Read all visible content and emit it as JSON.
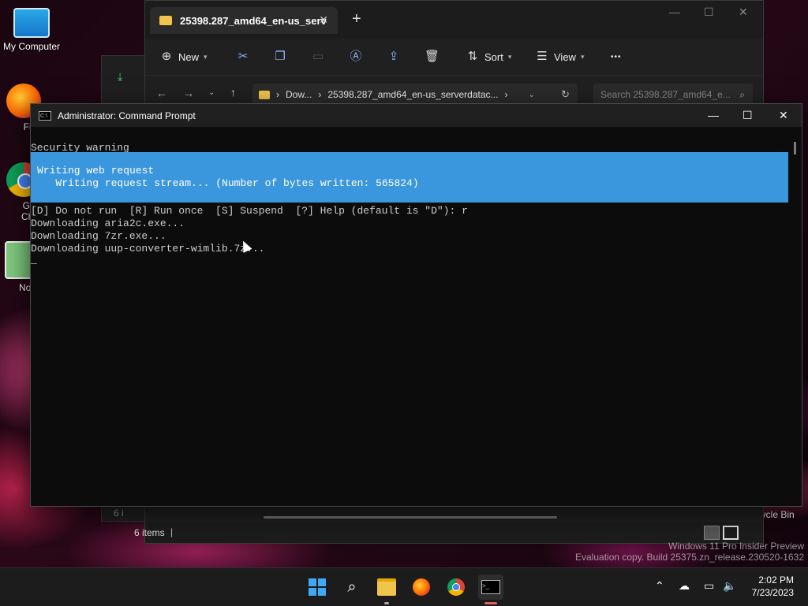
{
  "desktop": {
    "icons": [
      {
        "label": "My Computer"
      },
      {
        "label": "Fire"
      },
      {
        "label": "Goo Chro"
      },
      {
        "label": "Notep"
      },
      {
        "label": "Recycle Bin"
      }
    ]
  },
  "explorer": {
    "tab_title": "25398.287_amd64_en-us_serv",
    "toolbar": {
      "new_label": "New",
      "sort_label": "Sort",
      "view_label": "View",
      "more_label": "•••"
    },
    "address": {
      "crumb1": "Dow...",
      "crumb2": "25398.287_amd64_en-us_serverdatac...",
      "sep": "›"
    },
    "search_placeholder": "Search 25398.287_amd64_e...",
    "status_items": "6 items",
    "hidden_left_text": "6 i"
  },
  "cmd": {
    "title": "Administrator: Command Prompt",
    "lines": {
      "security": "Security warning",
      "progress_title": "Writing web request",
      "progress_detail": "   Writing request stream... (Number of bytes written: 565824)",
      "prompt": "[D] Do not run  [R] Run once  [S] Suspend  [?] Help (default is \"D\"): r",
      "dl1": "Downloading aria2c.exe...",
      "dl2": "Downloading 7zr.exe...",
      "dl3": "Downloading uup-converter-wimlib.7z...",
      "cursor": "_"
    }
  },
  "watermark": {
    "line1": "Windows 11 Pro Insider Preview",
    "line2": "Evaluation copy. Build 25375.zn_release.230520-1632"
  },
  "taskbar": {
    "time": "2:02 PM",
    "date": "7/23/2023",
    "apps": [
      "start-icon",
      "search-icon",
      "file-explorer-icon",
      "firefox-icon",
      "chrome-icon",
      "terminal-icon"
    ]
  },
  "colors": {
    "accent": "#3a96dd",
    "folder": "#f1c44b"
  }
}
